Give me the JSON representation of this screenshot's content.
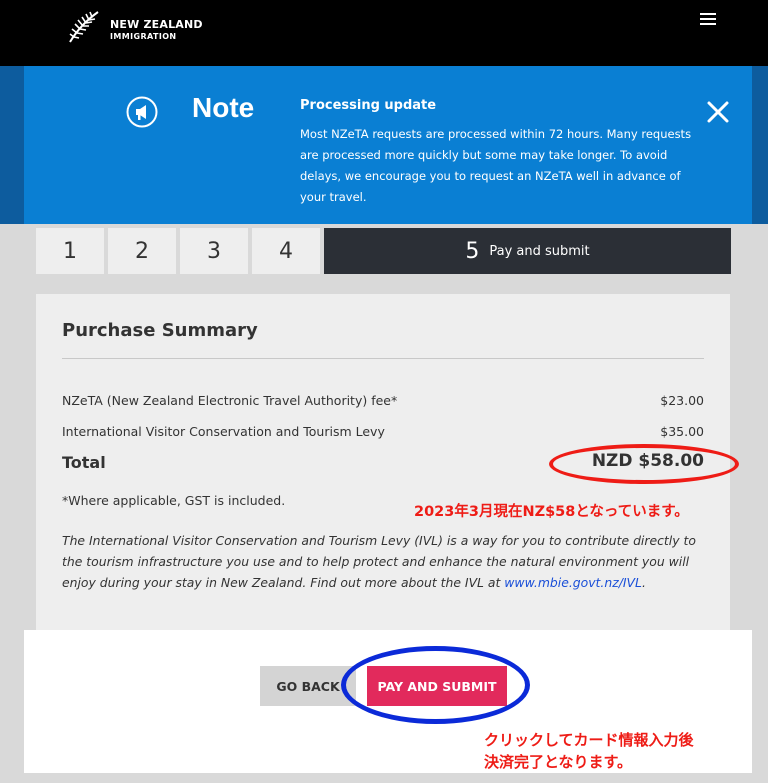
{
  "header": {
    "logo_line1": "NEW ZEALAND",
    "logo_line2": "IMMIGRATION",
    "menu_icon": "hamburger-menu-icon"
  },
  "notice": {
    "title": "Note",
    "heading": "Processing update",
    "body": "Most NZeTA requests are processed within 72 hours. Many requests are processed more quickly but some may take longer. To avoid delays, we encourage you to request an NZeTA well in advance of your travel.",
    "bg_color": "#0a7fd3"
  },
  "steps": {
    "items": [
      "1",
      "2",
      "3",
      "4"
    ],
    "active_number": "5",
    "active_label": "Pay and submit"
  },
  "summary": {
    "title": "Purchase Summary",
    "rows": [
      {
        "label": "NZeTA (New Zealand Electronic Travel Authority) fee*",
        "value": "$23.00"
      },
      {
        "label": "International Visitor Conservation and Tourism Levy",
        "value": "$35.00"
      }
    ],
    "total_label": "Total",
    "total_value": "NZD $58.00",
    "gst_note": "*Where applicable, GST is included.",
    "ivl_text": "The International Visitor Conservation and Tourism Levy (IVL) is a way for you to contribute directly to the tourism infrastructure you use and to help protect and enhance the natural environment you will enjoy during your stay in New Zealand. Find out more about the IVL at ",
    "ivl_link": "www.mbie.govt.nz/IVL",
    "ivl_end": "."
  },
  "buttons": {
    "back": "GO BACK",
    "pay": "PAY AND SUBMIT",
    "pay_color": "#e22a5c"
  },
  "annotations": {
    "price_note": "2023年3月現在NZ$58となっています。",
    "click_note_line1": "クリックしてカード情報入力後",
    "click_note_line2": "決済完了となります。"
  }
}
